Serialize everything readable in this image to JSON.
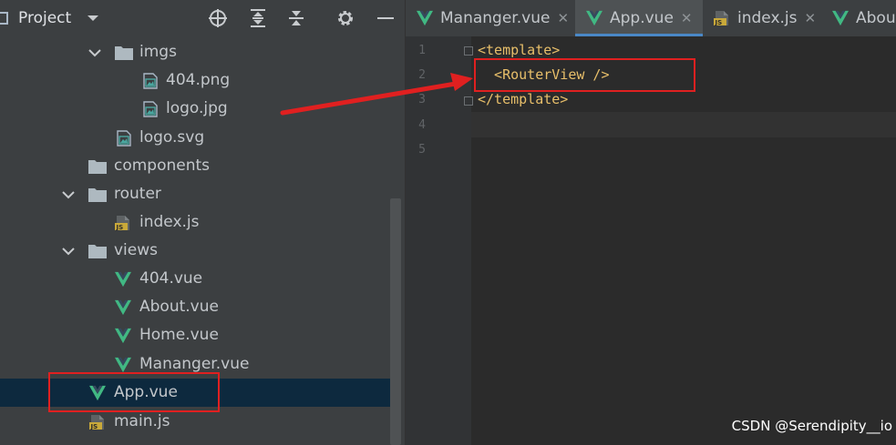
{
  "project_panel": {
    "title": "Project",
    "toolbar_icons": [
      "chevron-down-icon",
      "locate-icon",
      "expand-all-icon",
      "collapse-all-icon",
      "gear-icon",
      "minimize-icon"
    ],
    "tree": [
      {
        "label": "imgs",
        "type": "folder",
        "expanded": true
      },
      {
        "label": "404.png",
        "type": "image-file"
      },
      {
        "label": "logo.jpg",
        "type": "image-file"
      },
      {
        "label": "logo.svg",
        "type": "image-file"
      },
      {
        "label": "components",
        "type": "folder"
      },
      {
        "label": "router",
        "type": "folder",
        "expanded": true
      },
      {
        "label": "index.js",
        "type": "js-file"
      },
      {
        "label": "views",
        "type": "folder",
        "expanded": true
      },
      {
        "label": "404.vue",
        "type": "vue-file"
      },
      {
        "label": "About.vue",
        "type": "vue-file"
      },
      {
        "label": "Home.vue",
        "type": "vue-file"
      },
      {
        "label": "Mananger.vue",
        "type": "vue-file"
      },
      {
        "label": "App.vue",
        "type": "vue-file",
        "selected": true
      },
      {
        "label": "main.js",
        "type": "js-file"
      }
    ]
  },
  "tabs": [
    {
      "label": "Mananger.vue",
      "type": "vue-file",
      "close": "✕"
    },
    {
      "label": "App.vue",
      "type": "vue-file",
      "active": true,
      "close": "✕"
    },
    {
      "label": "index.js",
      "type": "js-file",
      "close": "✕"
    },
    {
      "label": "About",
      "type": "vue-file"
    }
  ],
  "editor": {
    "line_numbers": [
      "1",
      "2",
      "3",
      "4",
      "5"
    ],
    "lines": [
      "<template>",
      "  <RouterView />",
      "</template>",
      "",
      ""
    ],
    "current_line": 4
  },
  "watermark": "CSDN @Serendipity__io",
  "colors": {
    "vue_green": "#41b883",
    "tag_yellow": "#e8bf6a",
    "selection_blue": "#0d293e",
    "annotation_red": "#e02020",
    "tab_underline": "#4a88c7"
  }
}
